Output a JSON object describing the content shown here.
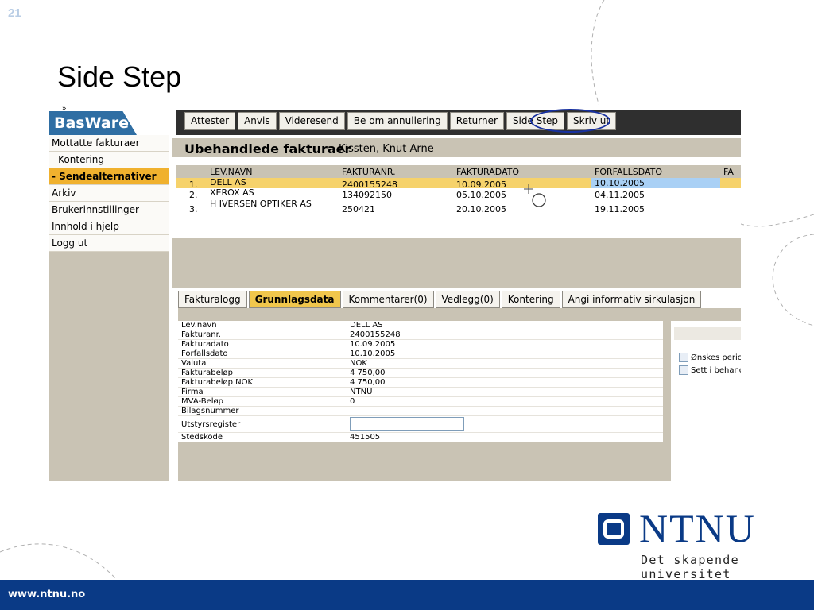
{
  "slide": {
    "number": "21",
    "title": "Side Step",
    "footer_url": "www.ntnu.no",
    "brand": "NTNU",
    "brand_tagline": "Det skapende universitet"
  },
  "app": {
    "logo": "BasWare",
    "toolbar": [
      "Attester",
      "Anvis",
      "Videresend",
      "Be om annullering",
      "Returner",
      "Side Step",
      "Skriv ut"
    ],
    "sidebar": [
      {
        "label": "Mottatte fakturaer",
        "active": false
      },
      {
        "label": "- Kontering",
        "active": false
      },
      {
        "label": "- Sendealternativer",
        "active": true
      },
      {
        "label": "Arkiv",
        "active": false
      },
      {
        "label": "Brukerinnstillinger",
        "active": false
      },
      {
        "label": "Innhold i hjelp",
        "active": false
      },
      {
        "label": "Logg ut",
        "active": false
      }
    ],
    "list_title": "Ubehandlede fakturaer",
    "list_user": "Kissten, Knut Arne",
    "grid_headers": [
      "LEV.NAVN",
      "FAKTURANR.",
      "FAKTURADATO",
      "FORFALLSDATO",
      "FA"
    ],
    "grid_rows": [
      {
        "no": "1.",
        "name": "DELL AS",
        "invoice": "2400155248",
        "date": "10.09.2005",
        "due": "10.10.2005"
      },
      {
        "no": "2.",
        "name": "XEROX AS",
        "invoice": "134092150",
        "date": "05.10.2005",
        "due": "04.11.2005"
      },
      {
        "no": "3.",
        "name": "H IVERSEN OPTIKER AS",
        "invoice": "250421",
        "date": "20.10.2005",
        "due": "19.11.2005"
      }
    ],
    "tabs": [
      {
        "label": "Fakturalogg",
        "active": false
      },
      {
        "label": "Grunnlagsdata",
        "active": true
      },
      {
        "label": "Kommentarer(0)",
        "active": false
      },
      {
        "label": "Vedlegg(0)",
        "active": false
      },
      {
        "label": "Kontering",
        "active": false
      },
      {
        "label": "Angi informativ sirkulasjon",
        "active": false
      }
    ],
    "details": [
      {
        "key": "Lev.navn",
        "value": "DELL AS"
      },
      {
        "key": "Fakturanr.",
        "value": "2400155248"
      },
      {
        "key": "Fakturadato",
        "value": "10.09.2005"
      },
      {
        "key": "Forfallsdato",
        "value": "10.10.2005"
      },
      {
        "key": "Valuta",
        "value": "NOK"
      },
      {
        "key": "Fakturabeløp",
        "value": "4 750,00"
      },
      {
        "key": "Fakturabeløp NOK",
        "value": "4 750,00"
      },
      {
        "key": "Firma",
        "value": "NTNU"
      },
      {
        "key": "MVA-Beløp",
        "value": "0"
      },
      {
        "key": "Bilagsnummer",
        "value": ""
      },
      {
        "key": "Utstyrsregister",
        "value": "",
        "input": true
      },
      {
        "key": "Stedskode",
        "value": "451505"
      }
    ],
    "checkboxes": [
      "Ønskes peric",
      "Sett i behanc"
    ]
  }
}
